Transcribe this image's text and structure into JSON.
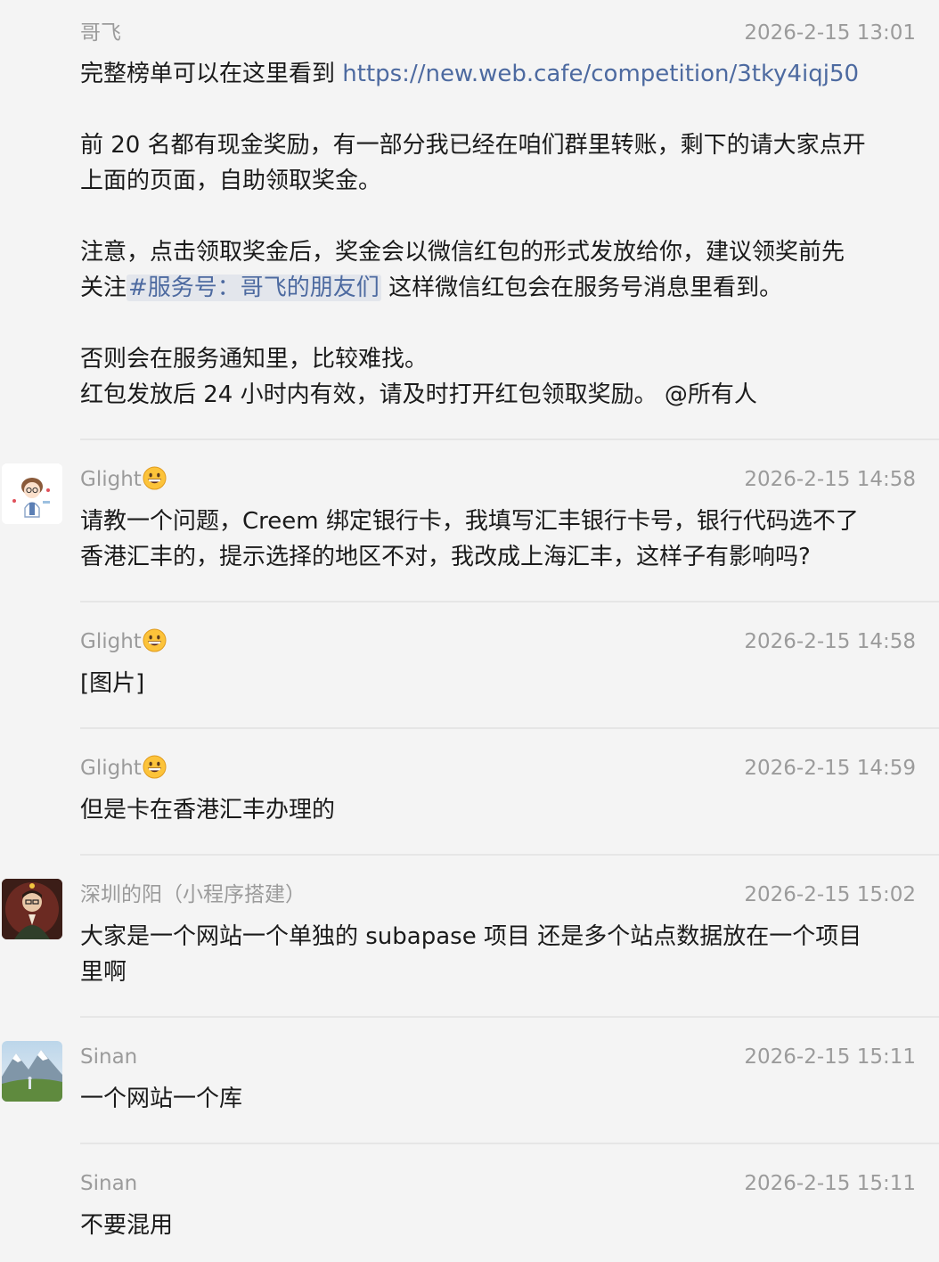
{
  "messages": [
    {
      "sender": "哥飞",
      "time": "2026-2-15 13:01",
      "line1_prefix": "完整榜单可以在这里看到 ",
      "line1_link": "https://new.web.cafe/competition/3tky4iqj50",
      "para2_line1": "前 20 名都有现金奖励，有一部分我已经在咱们群里转账，剩下的请大家点开",
      "para2_line2": "上面的页面，自助领取奖金。",
      "para3_line1": "注意，点击领取奖金后，奖金会以微信红包的形式发放给你，建议领奖前先",
      "para3_line2_prefix": "关注",
      "para3_line2_tag": "#服务号：哥飞的朋友们",
      "para3_line2_suffix": " 这样微信红包会在服务号消息里看到。",
      "para4_line1": "否则会在服务通知里，比较难找。",
      "para4_line2": "红包发放后 24 小时内有效，请及时打开红包领取奖励。 @所有人"
    },
    {
      "sender": "Glight",
      "time": "2026-2-15 14:58",
      "line1": "请教一个问题，Creem 绑定银行卡，我填写汇丰银行卡号，银行代码选不了",
      "line2": "香港汇丰的，提示选择的地区不对，我改成上海汇丰，这样子有影响吗?"
    },
    {
      "sender": "Glight",
      "time": "2026-2-15 14:58",
      "line1": "[图片]"
    },
    {
      "sender": "Glight",
      "time": "2026-2-15 14:59",
      "line1": "但是卡在香港汇丰办理的"
    },
    {
      "sender": "深圳的阳（小程序搭建）",
      "time": "2026-2-15 15:02",
      "line1": "大家是一个网站一个单独的 subapase 项目 还是多个站点数据放在一个项目",
      "line2": "里啊"
    },
    {
      "sender": "Sinan",
      "time": "2026-2-15 15:11",
      "line1": "一个网站一个库"
    },
    {
      "sender": "Sinan",
      "time": "2026-2-15 15:11",
      "line1": "不要混用"
    }
  ],
  "icons": {
    "sender_emoji": "grinning-face-icon"
  },
  "colors": {
    "background": "#f4f4f4",
    "link": "#4d6aa0",
    "meta_text": "#9b9b9b",
    "divider": "#e6e6e6"
  }
}
